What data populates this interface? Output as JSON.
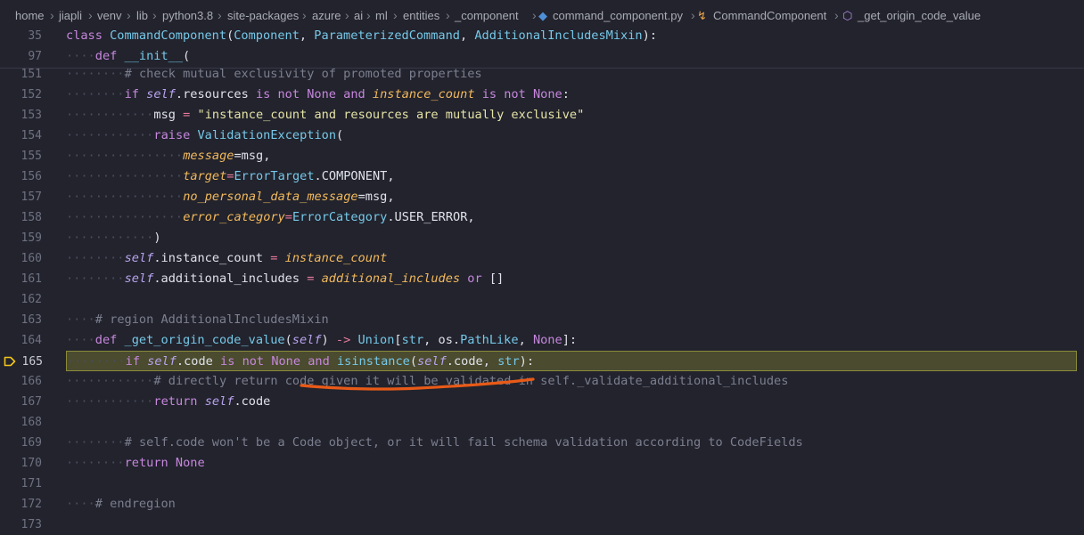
{
  "breadcrumb": [
    {
      "text": "home",
      "kind": "folder"
    },
    {
      "text": "jiapli",
      "kind": "folder"
    },
    {
      "text": "venv",
      "kind": "folder"
    },
    {
      "text": "lib",
      "kind": "folder"
    },
    {
      "text": "python3.8",
      "kind": "folder"
    },
    {
      "text": "site-packages",
      "kind": "folder"
    },
    {
      "text": "azure",
      "kind": "folder"
    },
    {
      "text": "ai",
      "kind": "folder"
    },
    {
      "text": "ml",
      "kind": "folder"
    },
    {
      "text": "entities",
      "kind": "folder"
    },
    {
      "text": "_component",
      "kind": "folder"
    },
    {
      "text": "command_component.py",
      "kind": "file",
      "icon": "python-file-icon"
    },
    {
      "text": "CommandComponent",
      "kind": "class",
      "icon": "class-symbol-icon"
    },
    {
      "text": "_get_origin_code_value",
      "kind": "method",
      "icon": "method-symbol-icon"
    }
  ],
  "sticky": [
    {
      "ln": "35"
    },
    {
      "ln": "97"
    }
  ],
  "lines": [
    {
      "ln": "151"
    },
    {
      "ln": "152"
    },
    {
      "ln": "153"
    },
    {
      "ln": "154"
    },
    {
      "ln": "155"
    },
    {
      "ln": "156"
    },
    {
      "ln": "157"
    },
    {
      "ln": "158"
    },
    {
      "ln": "159"
    },
    {
      "ln": "160"
    },
    {
      "ln": "161"
    },
    {
      "ln": "162"
    },
    {
      "ln": "163"
    },
    {
      "ln": "164"
    },
    {
      "ln": "165"
    },
    {
      "ln": "166"
    },
    {
      "ln": "167"
    },
    {
      "ln": "168"
    },
    {
      "ln": "169"
    },
    {
      "ln": "170"
    },
    {
      "ln": "171"
    },
    {
      "ln": "172"
    },
    {
      "ln": "173"
    }
  ],
  "tokens": {
    "l35": [
      "class",
      " ",
      "CommandComponent",
      "(",
      "Component",
      ", ",
      "ParameterizedCommand",
      ", ",
      "AdditionalIncludesMixin",
      "):"
    ],
    "l97": [
      "def",
      " ",
      "__init__",
      "("
    ],
    "l151": [
      "# check mutual exclusivity of promoted properties"
    ],
    "l152": [
      "if",
      " ",
      "self",
      ".resources ",
      "is not",
      " ",
      "None",
      " ",
      "and",
      " ",
      "instance_count",
      " ",
      "is not",
      " ",
      "None",
      ":"
    ],
    "l153": [
      "msg",
      " = ",
      "\"instance_count and resources are mutually exclusive\""
    ],
    "l154": [
      "raise",
      " ",
      "ValidationException",
      "("
    ],
    "l155": [
      "message",
      "=msg,"
    ],
    "l156": [
      "target",
      "=",
      "ErrorTarget",
      ".COMPONENT,"
    ],
    "l157": [
      "no_personal_data_message",
      "=msg,"
    ],
    "l158": [
      "error_category",
      "=",
      "ErrorCategory",
      ".USER_ERROR,"
    ],
    "l159": [
      ")"
    ],
    "l160": [
      "self",
      ".instance_count",
      " = ",
      "instance_count"
    ],
    "l161": [
      "self",
      ".additional_includes",
      " = ",
      "additional_includes",
      " ",
      "or",
      " []"
    ],
    "l163": [
      "# region AdditionalIncludesMixin"
    ],
    "l164": [
      "def",
      " ",
      "_get_origin_code_value",
      "(",
      "self",
      ") ",
      "->",
      " ",
      "Union",
      "[",
      "str",
      ", os.",
      "PathLike",
      ", ",
      "None",
      "]:"
    ],
    "l165": [
      "if",
      " ",
      "self",
      ".code ",
      "is not",
      " ",
      "None",
      " ",
      "and",
      " ",
      "isinstance",
      "(",
      "self",
      ".code, ",
      "str",
      "):"
    ],
    "l166": [
      "# directly return code given it will be validated in self._validate_additional_includes"
    ],
    "l167": [
      "return",
      " ",
      "self",
      ".code"
    ],
    "l169": [
      "# self.code won't be a Code object, or it will fail schema validation according to CodeFields"
    ],
    "l170": [
      "return",
      " ",
      "None"
    ],
    "l172": [
      "# endregion"
    ]
  },
  "colors": {
    "background": "#22232d",
    "line_highlight": "#4a4b2f",
    "breakpoint_arrow": "#f5c518",
    "annotation_stroke": "#e85a17"
  }
}
